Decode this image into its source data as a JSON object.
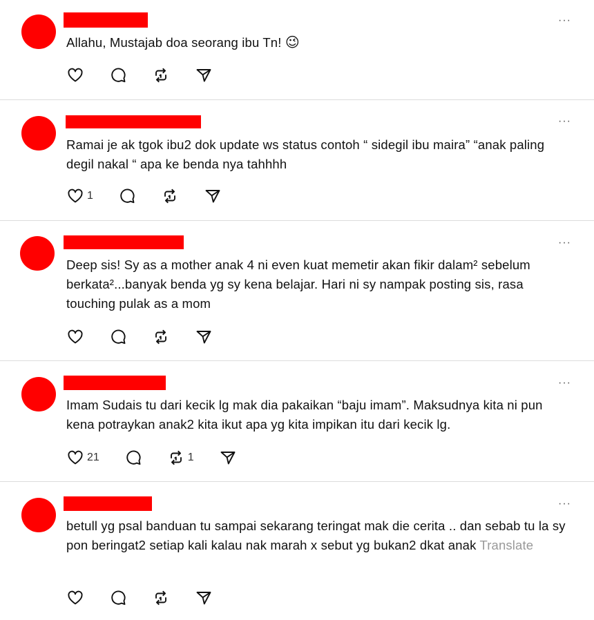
{
  "colors": {
    "redaction": "#ff0000",
    "divider": "#dcdcdc",
    "muted": "#999999",
    "text": "#111111"
  },
  "icons": {
    "like": "heart-icon",
    "reply": "comment-icon",
    "repost": "repost-icon",
    "share": "share-icon",
    "more": "more-dots-icon",
    "emoji": "winking-face-emoji"
  },
  "more_label": "···",
  "posts": [
    {
      "text": "Allahu, Mustajab doa seorang ibu Tn! ",
      "emoji": "😉",
      "likes": "",
      "reposts": "",
      "translate": ""
    },
    {
      "text": "Ramai je ak tgok ibu2 dok update ws status contoh “ sidegil ibu maira” “anak paling degil nakal “ apa ke benda nya tahhhh",
      "likes": "1",
      "reposts": "",
      "translate": ""
    },
    {
      "text": "Deep sis! Sy as a mother anak 4 ni even kuat memetir akan fikir dalam² sebelum berkata²...banyak benda yg sy kena belajar. Hari ni sy nampak posting sis, rasa touching pulak as a mom",
      "likes": "",
      "reposts": "",
      "translate": ""
    },
    {
      "text": "Imam Sudais tu dari kecik lg mak dia pakaikan “baju imam”. Maksudnya kita ni pun kena potraykan anak2 kita ikut apa yg kita impikan itu dari kecik lg.",
      "likes": "21",
      "reposts": "1",
      "translate": ""
    },
    {
      "text": "betull yg psal banduan tu sampai sekarang teringat mak die cerita .. dan sebab tu la sy pon beringat2 setiap kali kalau nak marah x sebut yg bukan2 dkat anak ",
      "likes": "",
      "reposts": "",
      "translate": "Translate"
    }
  ]
}
